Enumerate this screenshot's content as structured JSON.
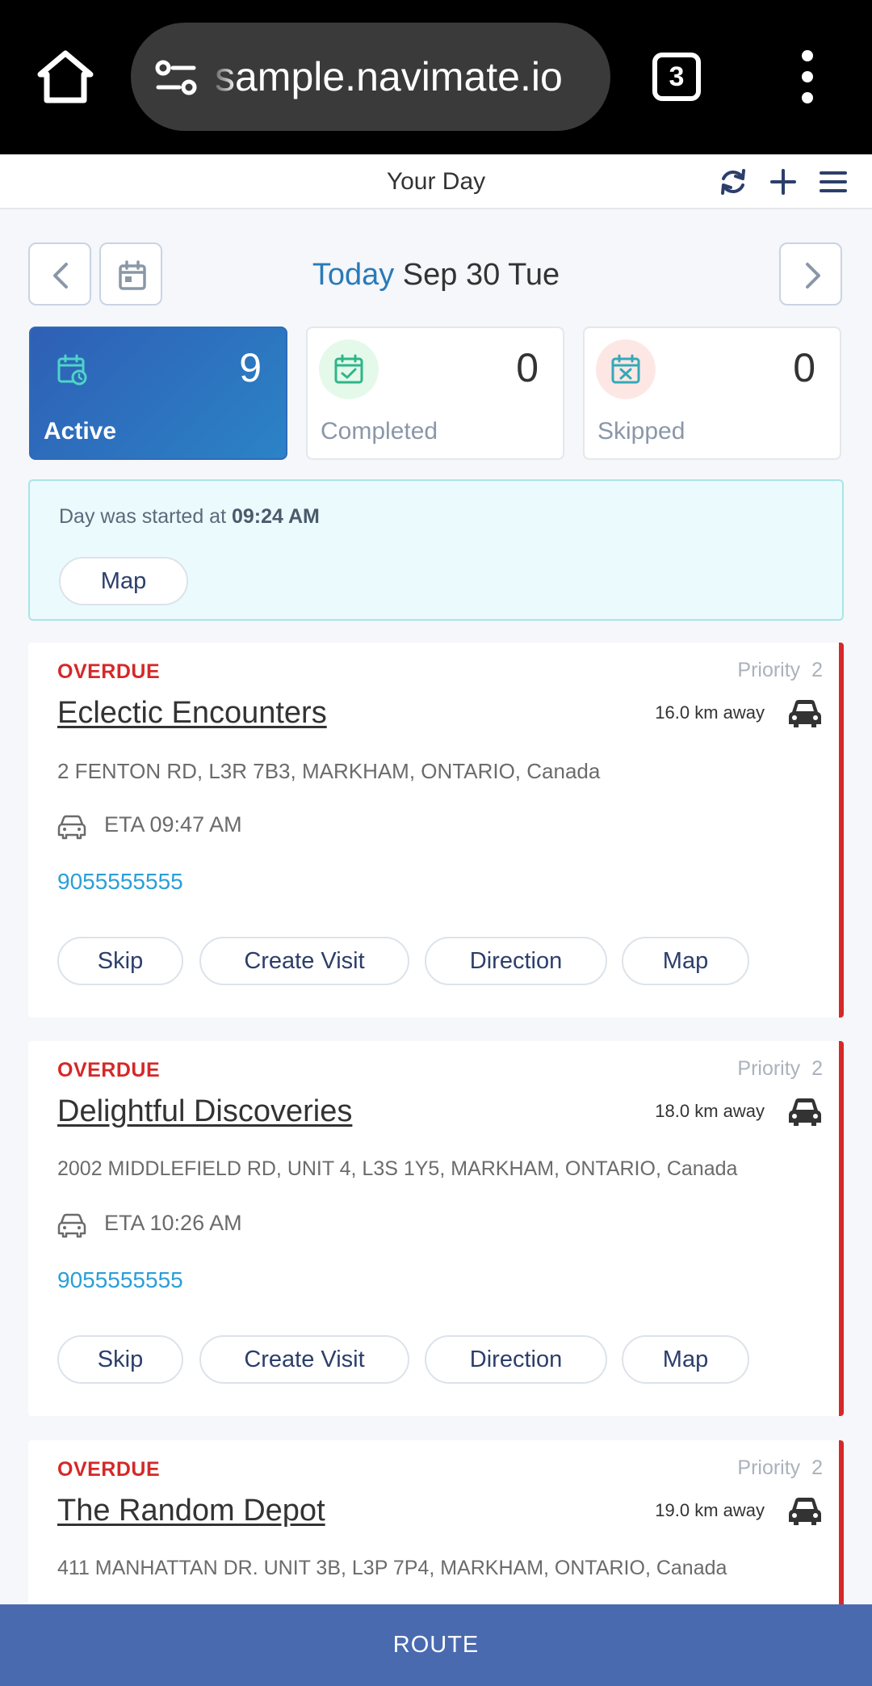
{
  "browser": {
    "url": "sample.navimate.io",
    "tab_count": "3"
  },
  "header": {
    "title": "Your Day"
  },
  "date_nav": {
    "today_word": "Today",
    "date_text": "Sep 30 Tue"
  },
  "stats": {
    "active": {
      "count": "9",
      "label": "Active"
    },
    "completed": {
      "count": "0",
      "label": "Completed"
    },
    "skipped": {
      "count": "0",
      "label": "Skipped"
    }
  },
  "day_info": {
    "started_prefix": "Day was started at",
    "started_time": "09:24 AM",
    "map_label": "Map"
  },
  "stops": [
    {
      "status": "OVERDUE",
      "priority_label": "Priority",
      "priority_value": "2",
      "name": "Eclectic Encounters",
      "distance": "16.0 km away",
      "address": "2 FENTON RD, L3R 7B3, MARKHAM, ONTARIO, Canada",
      "eta": "ETA 09:47 AM",
      "phone": "9055555555",
      "actions": {
        "skip": "Skip",
        "create_visit": "Create Visit",
        "direction": "Direction",
        "map": "Map"
      }
    },
    {
      "status": "OVERDUE",
      "priority_label": "Priority",
      "priority_value": "2",
      "name": "Delightful Discoveries",
      "distance": "18.0 km away",
      "address": "2002 MIDDLEFIELD RD, UNIT 4, L3S 1Y5, MARKHAM, ONTARIO, Canada",
      "eta": "ETA 10:26 AM",
      "phone": "9055555555",
      "actions": {
        "skip": "Skip",
        "create_visit": "Create Visit",
        "direction": "Direction",
        "map": "Map"
      }
    },
    {
      "status": "OVERDUE",
      "priority_label": "Priority",
      "priority_value": "2",
      "name": "The Random Depot",
      "distance": "19.0 km away",
      "address": "411 MANHATTAN DR. UNIT 3B, L3P 7P4, MARKHAM, ONTARIO, Canada"
    }
  ],
  "bottom": {
    "route_label": "ROUTE"
  },
  "icons": {
    "home": "home-icon",
    "site_settings": "tune-icon",
    "refresh": "refresh-icon",
    "add": "plus-icon",
    "menu": "hamburger-icon",
    "calendar": "calendar-icon",
    "car": "car-icon"
  },
  "colors": {
    "accent_blue": "#2a7ab8",
    "overdue_red": "#d62828",
    "phone_blue": "#2a9fd6",
    "route_bar": "#4a6ab0"
  }
}
